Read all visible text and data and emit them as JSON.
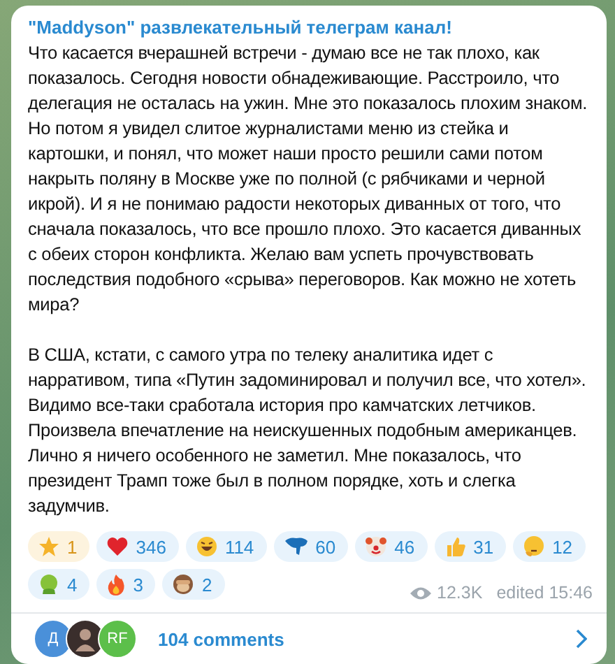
{
  "post": {
    "channel_title": "\"Maddyson\" развлекательный телеграм канал!",
    "paragraphs": [
      "Что касается вчерашней встречи - думаю все не так плохо, как показалось. Сегодня новости обнадеживающие. Расстроило, что делегация не осталась на ужин. Мне это показалось плохим знаком. Но потом я увидел слитое журналистами меню из стейка и картошки, и понял, что может наши просто решили сами потом накрыть поляну в Москве уже по полной (с рябчиками и черной икрой). И я не понимаю радости некоторых диванных от того, что сначала показалось, что все прошло плохо. Это касается диванных с обеих сторон конфликта. Желаю вам успеть прочувствовать последствия подобного «срыва» переговоров. Как можно не хотеть мира?",
      "В США, кстати, с самого утра по телеку аналитика идет с нарративом, типа «Путин задоминировал и получил все, что хотел». Видимо все-таки сработала история про камчатских летчиков. Произвела впечатление на неискушенных подобным американцев. Лично я ничего особенного не заметил. Мне показалось, что президент Трамп тоже был в полном порядке, хоть и слегка задумчив."
    ],
    "reactions": [
      {
        "kind": "star",
        "count": "1",
        "paid": true
      },
      {
        "kind": "heart",
        "count": "346",
        "paid": false
      },
      {
        "kind": "laughing",
        "count": "114",
        "paid": false
      },
      {
        "kind": "elephant",
        "count": "60",
        "paid": false
      },
      {
        "kind": "clown",
        "count": "46",
        "paid": false
      },
      {
        "kind": "thumbs-up",
        "count": "31",
        "paid": false
      },
      {
        "kind": "thinking",
        "count": "12",
        "paid": false
      },
      {
        "kind": "sick",
        "count": "4",
        "paid": false
      },
      {
        "kind": "fire",
        "count": "3",
        "paid": false
      },
      {
        "kind": "monkey",
        "count": "2",
        "paid": false
      }
    ],
    "views": "12.3K",
    "edited": "edited 15:46",
    "comments": {
      "avatars": [
        {
          "kind": "letter",
          "text": "Д",
          "color": "#4a90d9"
        },
        {
          "kind": "photo"
        },
        {
          "kind": "letter",
          "text": "RF",
          "color": "#5cbf4a"
        }
      ],
      "label": "104 comments"
    }
  }
}
